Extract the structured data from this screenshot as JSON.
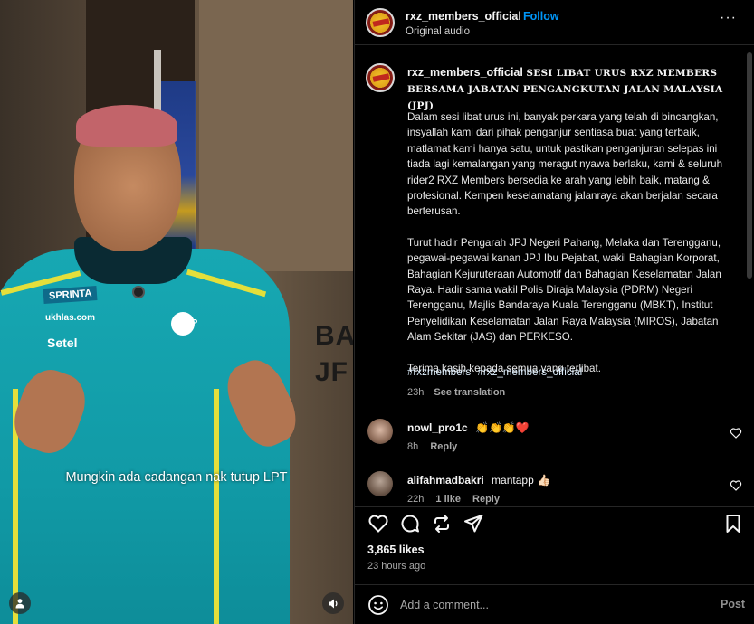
{
  "video": {
    "subtitle": "Mungkin ada cadangan nak tutup LPT",
    "signage": [
      "BA",
      "JF"
    ],
    "shirt_logos": {
      "sprinta": "SPRINTA",
      "uklas": "ukhlas.com",
      "setel": "Setel",
      "shop": "SHOP"
    }
  },
  "header": {
    "username": "rxz_members_official",
    "separator": "•",
    "follow_label": "Follow",
    "audio": "Original audio",
    "more": "···"
  },
  "caption": {
    "username": "rxz_members_official",
    "title": "SESI LIBAT URUS RXZ MEMBERS BERSAMA JABATAN PENGANGKUTAN JALAN MALAYSIA (JPJ)",
    "paragraphs": [
      "Dalam sesi libat urus ini, banyak perkara yang telah di bincangkan, insyallah kami dari pihak penganjur sentiasa buat yang terbaik, matlamat kami hanya satu, untuk pastikan penganjuran selepas ini tiada lagi kemalangan yang meragut nyawa berlaku, kami & seluruh rider2 RXZ Members bersedia ke arah yang lebih baik, matang & profesional. Kempen keselamatang jalanraya akan berjalan secara berterusan.",
      "Turut hadir Pengarah JPJ Negeri Pahang, Melaka dan Terengganu, pegawai-pegawai kanan JPJ Ibu Pejabat, wakil Bahagian Korporat, Bahagian Kejuruteraan Automotif dan Bahagian Keselamatan Jalan Raya. Hadir sama wakil Polis Diraja Malaysia (PDRM) Negeri Terengganu, Majlis Bandaraya Kuala Terengganu (MBKT), Institut Penyelidikan Keselamatan Jalan Raya Malaysia (MIROS), Jabatan Alam Sekitar (JAS) dan PERKESO.",
      "Terima kasih kepada semua yang terlibat."
    ],
    "hashtags": [
      "#rxzmembers",
      "#rxz_members_official"
    ],
    "time": "23h",
    "see_translation": "See translation"
  },
  "comments": [
    {
      "username": "nowl_pro1c",
      "text": "👏👏👏❤️",
      "time": "8h",
      "reply": "Reply",
      "likes": ""
    },
    {
      "username": "alifahmadbakri",
      "text": "mantapp 👍🏻",
      "time": "22h",
      "likes": "1 like",
      "reply": "Reply"
    }
  ],
  "actions": {
    "likes": "3,865 likes",
    "time": "23 hours ago"
  },
  "add_comment": {
    "placeholder": "Add a comment...",
    "post_label": "Post"
  },
  "colors": {
    "accent": "#0095f6",
    "background": "#000000",
    "text": "#f5f5f5",
    "muted": "#a8a8a8",
    "hashtag": "#e0f1ff"
  }
}
